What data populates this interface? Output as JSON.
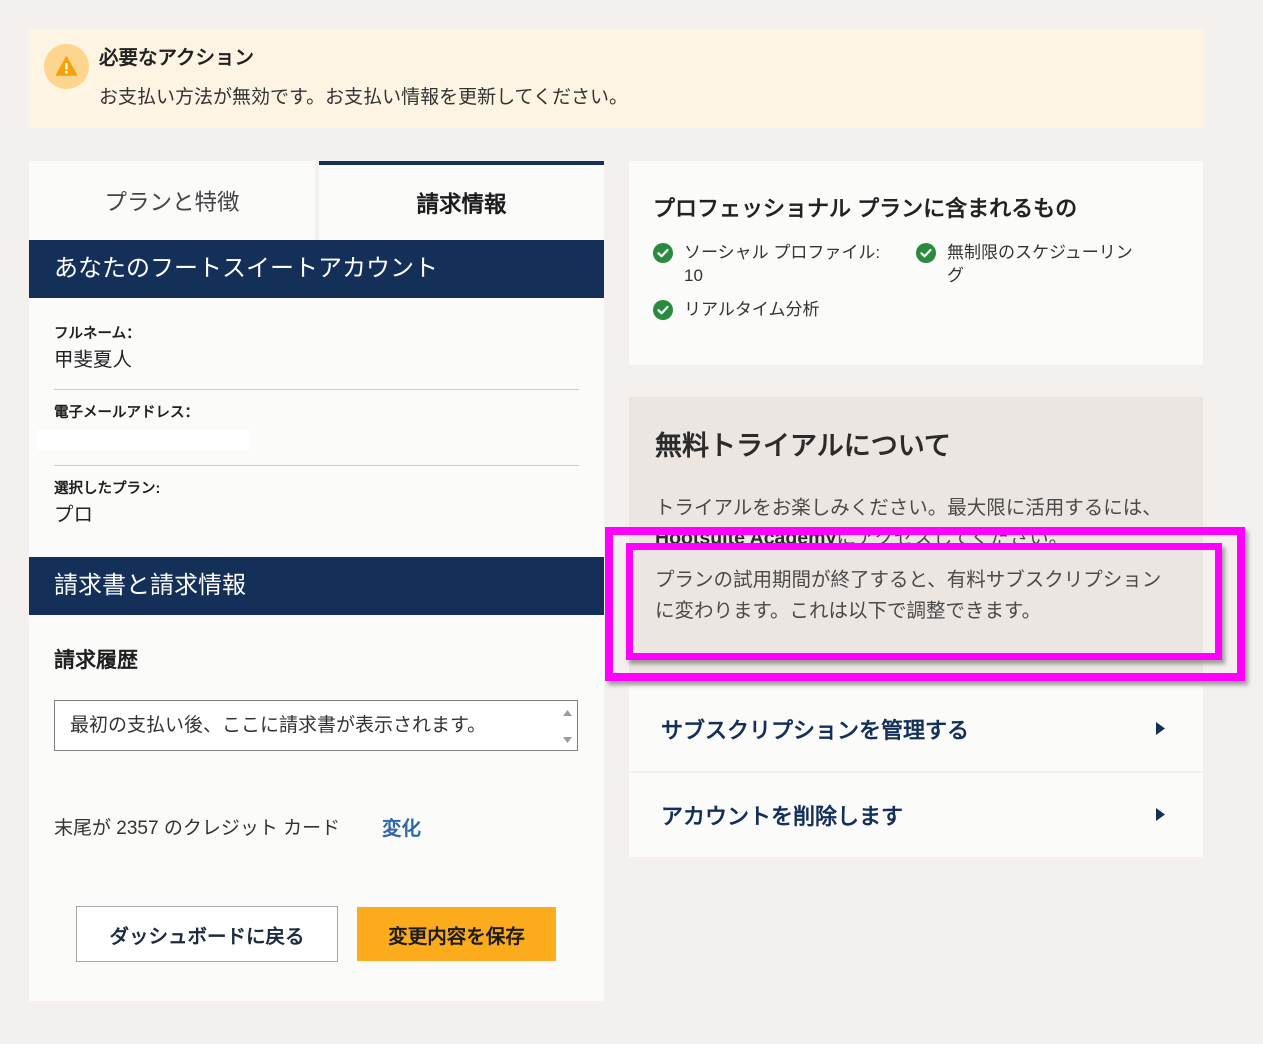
{
  "alert": {
    "icon": "warning-icon",
    "title": "必要なアクション",
    "message": "お支払い方法が無効です。お支払い情報を更新してください。"
  },
  "tabs": [
    {
      "label": "プランと特徴",
      "active": false
    },
    {
      "label": "請求情報",
      "active": true
    }
  ],
  "account": {
    "header": "あなたのフートスイートアカウント",
    "full_name_label": "フルネーム：",
    "full_name": "甲斐夏人",
    "email_label": "電子メールアドレス：",
    "plan_label": "選択したプラン:",
    "plan": "プロ"
  },
  "billing": {
    "header": "請求書と請求情報",
    "history_label": "請求履歴",
    "history_text": "最初の支払い後、ここに請求書が表示されます。",
    "card_text": "末尾が 2357 のクレジット カード",
    "change_link": "変化"
  },
  "actions": {
    "back_label": "ダッシュボードに戻る",
    "save_label": "変更内容を保存"
  },
  "plan_features": {
    "title": "プロフェッショナル プランに含まれるもの",
    "item_icon": "check-circle-icon",
    "items": [
      {
        "label": "ソーシャル プロファイル: 10"
      },
      {
        "label": "無制限のスケジューリング"
      },
      {
        "label": "リアルタイム分析"
      }
    ]
  },
  "trial": {
    "title": "無料トライアルについて",
    "intro": "トライアルをお楽しみください。最大限に活用するには、",
    "academy_link": "Hootsuite Academy",
    "intro_end": "にアクセスしてください。",
    "notice": "プランの試用期間が終了すると、有料サブスクリプションに変わります。これは以下で調整できます。"
  },
  "manage": {
    "icon": "chevron-right-icon",
    "items": [
      {
        "label": "サブスクリプションを管理する"
      },
      {
        "label": "アカウントを削除します"
      }
    ]
  },
  "colors": {
    "page_background": "#f3f0ed",
    "alert_background": "#fef4e3",
    "navy": "#143059",
    "primary_button": "#fbab1c",
    "link": "#2f68a5",
    "check": "#2a8a3e",
    "trial_card": "#ebe6e2",
    "highlight": "#ff00ff"
  }
}
